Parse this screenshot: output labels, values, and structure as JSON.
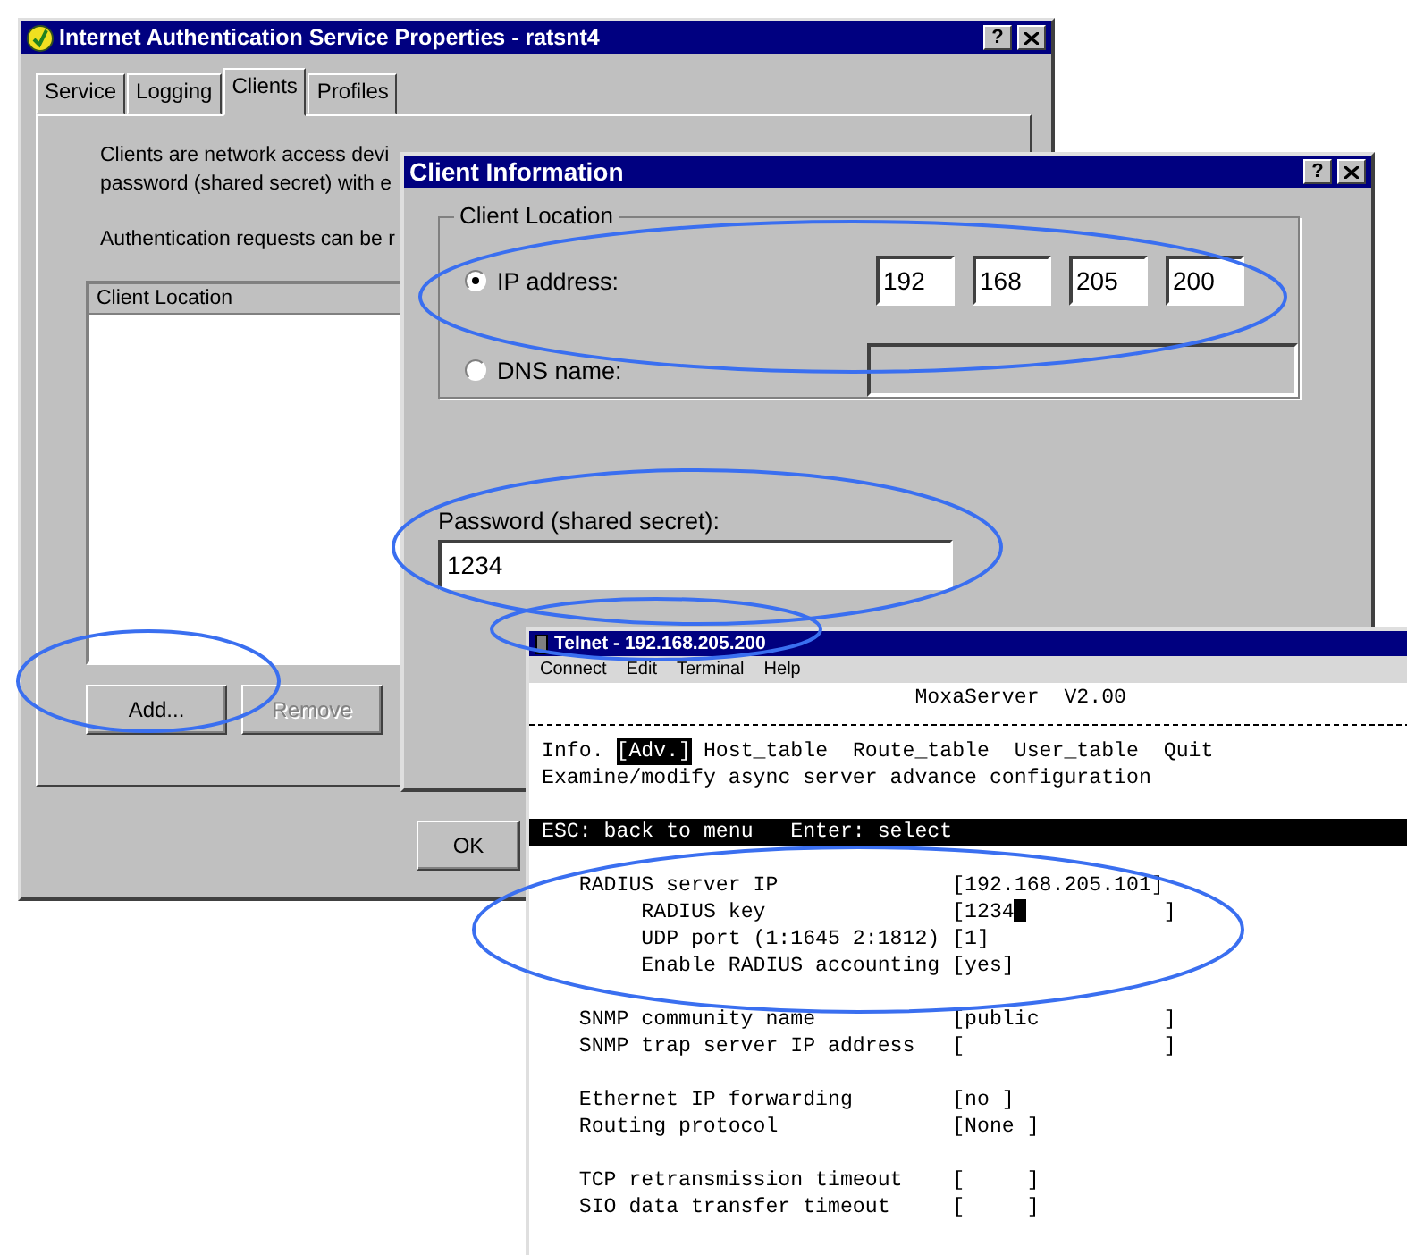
{
  "main_window": {
    "title": "Internet Authentication Service Properties - ratsnt4",
    "help_button": "?",
    "tabs": [
      {
        "label": "Service",
        "selected": false
      },
      {
        "label": "Logging",
        "selected": false
      },
      {
        "label": "Clients",
        "selected": true
      },
      {
        "label": "Profiles",
        "selected": false
      }
    ],
    "description_lines": [
      "Clients are network access devi",
      "password (shared secret) with e"
    ],
    "note": "Authentication requests can be r",
    "client_list": {
      "column": "Client Location"
    },
    "list_buttons": [
      {
        "label": "Add...",
        "disabled": false
      },
      {
        "label": "Remove",
        "disabled": true
      }
    ],
    "ok_button": "OK"
  },
  "client_dialog": {
    "title": "Client Information",
    "help_button": "?",
    "group_title": "Client Location",
    "options": [
      {
        "label": "IP address:",
        "selected": true,
        "kind": "octets",
        "octets": [
          "192",
          "168",
          "205",
          "200"
        ]
      },
      {
        "label": "DNS name:",
        "selected": false,
        "kind": "text",
        "disabled": true
      }
    ],
    "password_label": "Password (shared secret):",
    "password_value": "1234"
  },
  "telnet": {
    "title": "Telnet - 192.168.205.200",
    "menu": [
      "Connect",
      "Edit",
      "Terminal",
      "Help"
    ],
    "heading": "MoxaServer  V2.00",
    "menu_items": [
      {
        "label": "Info.",
        "selected": false
      },
      {
        "label": "[Adv.]",
        "selected": true
      },
      {
        "label": "Host_table",
        "selected": false
      },
      {
        "label": "Route_table",
        "selected": false
      },
      {
        "label": "User_table",
        "selected": false
      },
      {
        "label": "Quit",
        "selected": false
      }
    ],
    "description": "Examine/modify async server advance configuration",
    "key_bar": [
      "ESC: back to menu",
      "Enter: select"
    ],
    "settings": [
      [
        {
          "label": "RADIUS server IP",
          "value": "[192.168.205.101]",
          "children": [
            {
              "label": "RADIUS key",
              "value": "[1234",
              "cursor": true,
              "value_end": "           ]"
            },
            {
              "label": "UDP port (1:1645 2:1812)",
              "value": "[1]"
            },
            {
              "label": "Enable RADIUS accounting",
              "value": "[yes]"
            }
          ]
        }
      ],
      [
        {
          "label": "SNMP community name",
          "value": "[public          ]"
        },
        {
          "label": "SNMP trap server IP address",
          "value": "[                ]"
        }
      ],
      [
        {
          "label": "Ethernet IP forwarding",
          "value": "[no ]"
        },
        {
          "label": "Routing protocol",
          "value": "[None ]"
        }
      ],
      [
        {
          "label": "TCP retransmission timeout",
          "value": "[     ]"
        },
        {
          "label": "SIO data transfer timeout",
          "value": "[     ]"
        }
      ]
    ]
  }
}
